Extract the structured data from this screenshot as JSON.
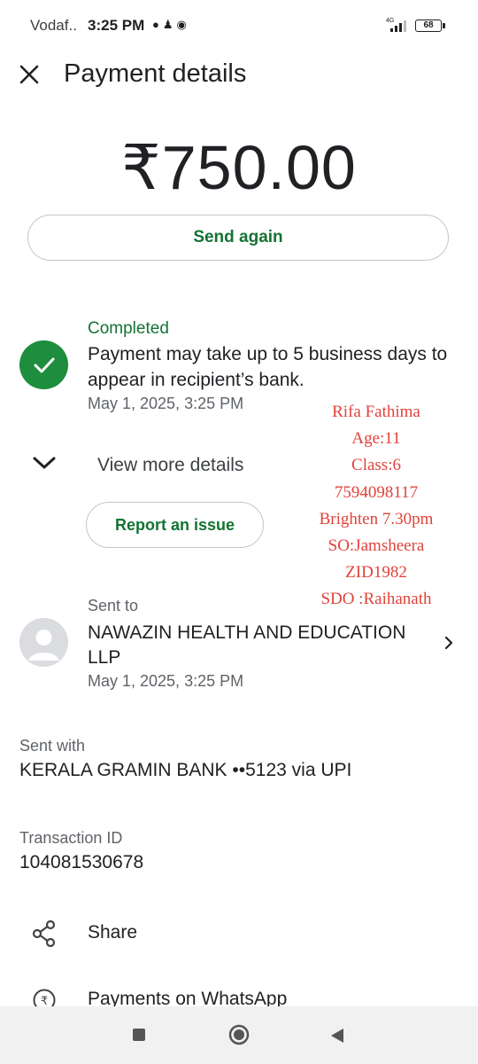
{
  "status_bar": {
    "carrier": "Vodaf..",
    "time": "3:25 PM",
    "notification_icons": [
      "chat-bubble-icon",
      "snapchat-icon",
      "whatsapp-icon"
    ],
    "network": "4G",
    "battery": "68"
  },
  "header": {
    "title": "Payment details"
  },
  "payment": {
    "amount": "₹750.00",
    "send_again_label": "Send again",
    "status": "Completed",
    "status_message": "Payment may take up to 5 business days to appear in recipient’s bank.",
    "date": "May 1, 2025, 3:25 PM",
    "view_more_label": "View more details",
    "report_issue_label": "Report an issue"
  },
  "annotation": {
    "lines": [
      "Rifa Fathima",
      "Age:11",
      "Class:6",
      "7594098117",
      "Brighten 7.30pm",
      "SO:Jamsheera",
      "ZID1982",
      "SDO :Raihanath"
    ],
    "color": "#e0433a"
  },
  "recipient": {
    "label": "Sent to",
    "name": "NAWAZIN HEALTH AND EDUCATION LLP",
    "date": "May 1, 2025, 3:25 PM"
  },
  "sent_with": {
    "label": "Sent with",
    "value": "KERALA GRAMIN BANK ••5123 via UPI"
  },
  "transaction": {
    "label": "Transaction ID",
    "value": "104081530678"
  },
  "actions": {
    "share_label": "Share",
    "whatsapp_label": "Payments on WhatsApp"
  },
  "colors": {
    "accent_green": "#137333",
    "success_green": "#1e8e3e"
  }
}
